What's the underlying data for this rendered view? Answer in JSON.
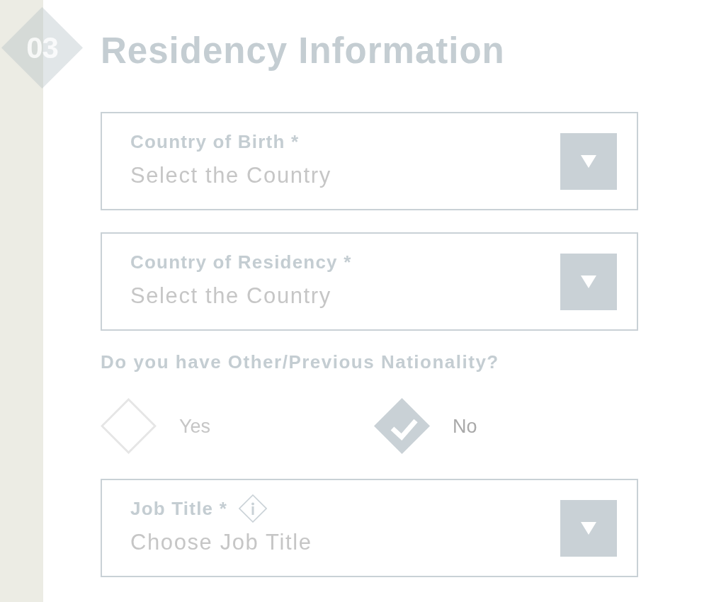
{
  "section": {
    "number": "03",
    "title": "Residency Information"
  },
  "form": [
    {
      "kind": "select",
      "label": "Country of Birth *",
      "info": false,
      "placeholder": "Select the Country"
    },
    {
      "kind": "select",
      "label": "Country of Residency *",
      "info": false,
      "placeholder": "Select the Country"
    },
    {
      "kind": "radio_group",
      "question": "Do you have Other/Previous Nationality?",
      "options": [
        {
          "label": "Yes",
          "selected": false
        },
        {
          "label": "No",
          "selected": true
        }
      ]
    },
    {
      "kind": "select",
      "label": "Job Title *",
      "info": true,
      "placeholder": "Choose Job Title"
    }
  ]
}
